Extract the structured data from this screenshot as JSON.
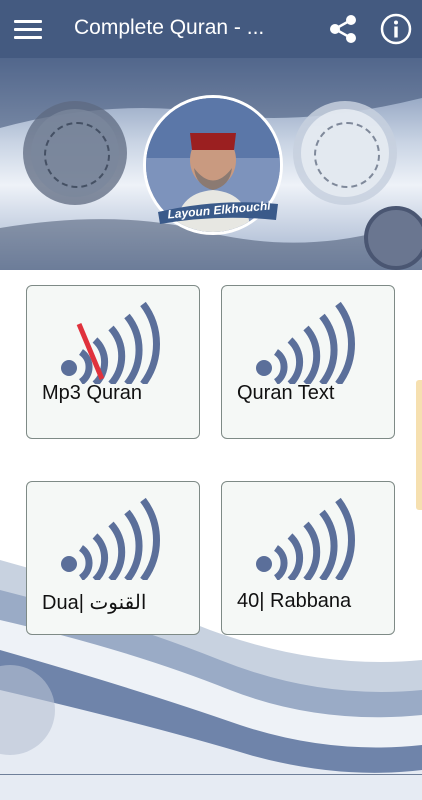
{
  "app": {
    "title": "Complete Quran - ...",
    "menu_icon": "hamburger-menu-icon",
    "share_icon": "share-icon",
    "info_icon": "info-icon"
  },
  "banner": {
    "reciter_name": "Layoun Elkhouchi"
  },
  "cards": [
    {
      "label": "Mp3 Quran",
      "icon": "mp3-broadcast-icon"
    },
    {
      "label": "Quran Text",
      "icon": "broadcast-icon"
    },
    {
      "label": "Dua| القنوت",
      "icon": "broadcast-icon"
    },
    {
      "label": "40| Rabbana",
      "icon": "broadcast-icon"
    }
  ],
  "colors": {
    "appbar": "#445a80",
    "icon_blue": "#5b6f9a",
    "strike_red": "#e0323c"
  }
}
